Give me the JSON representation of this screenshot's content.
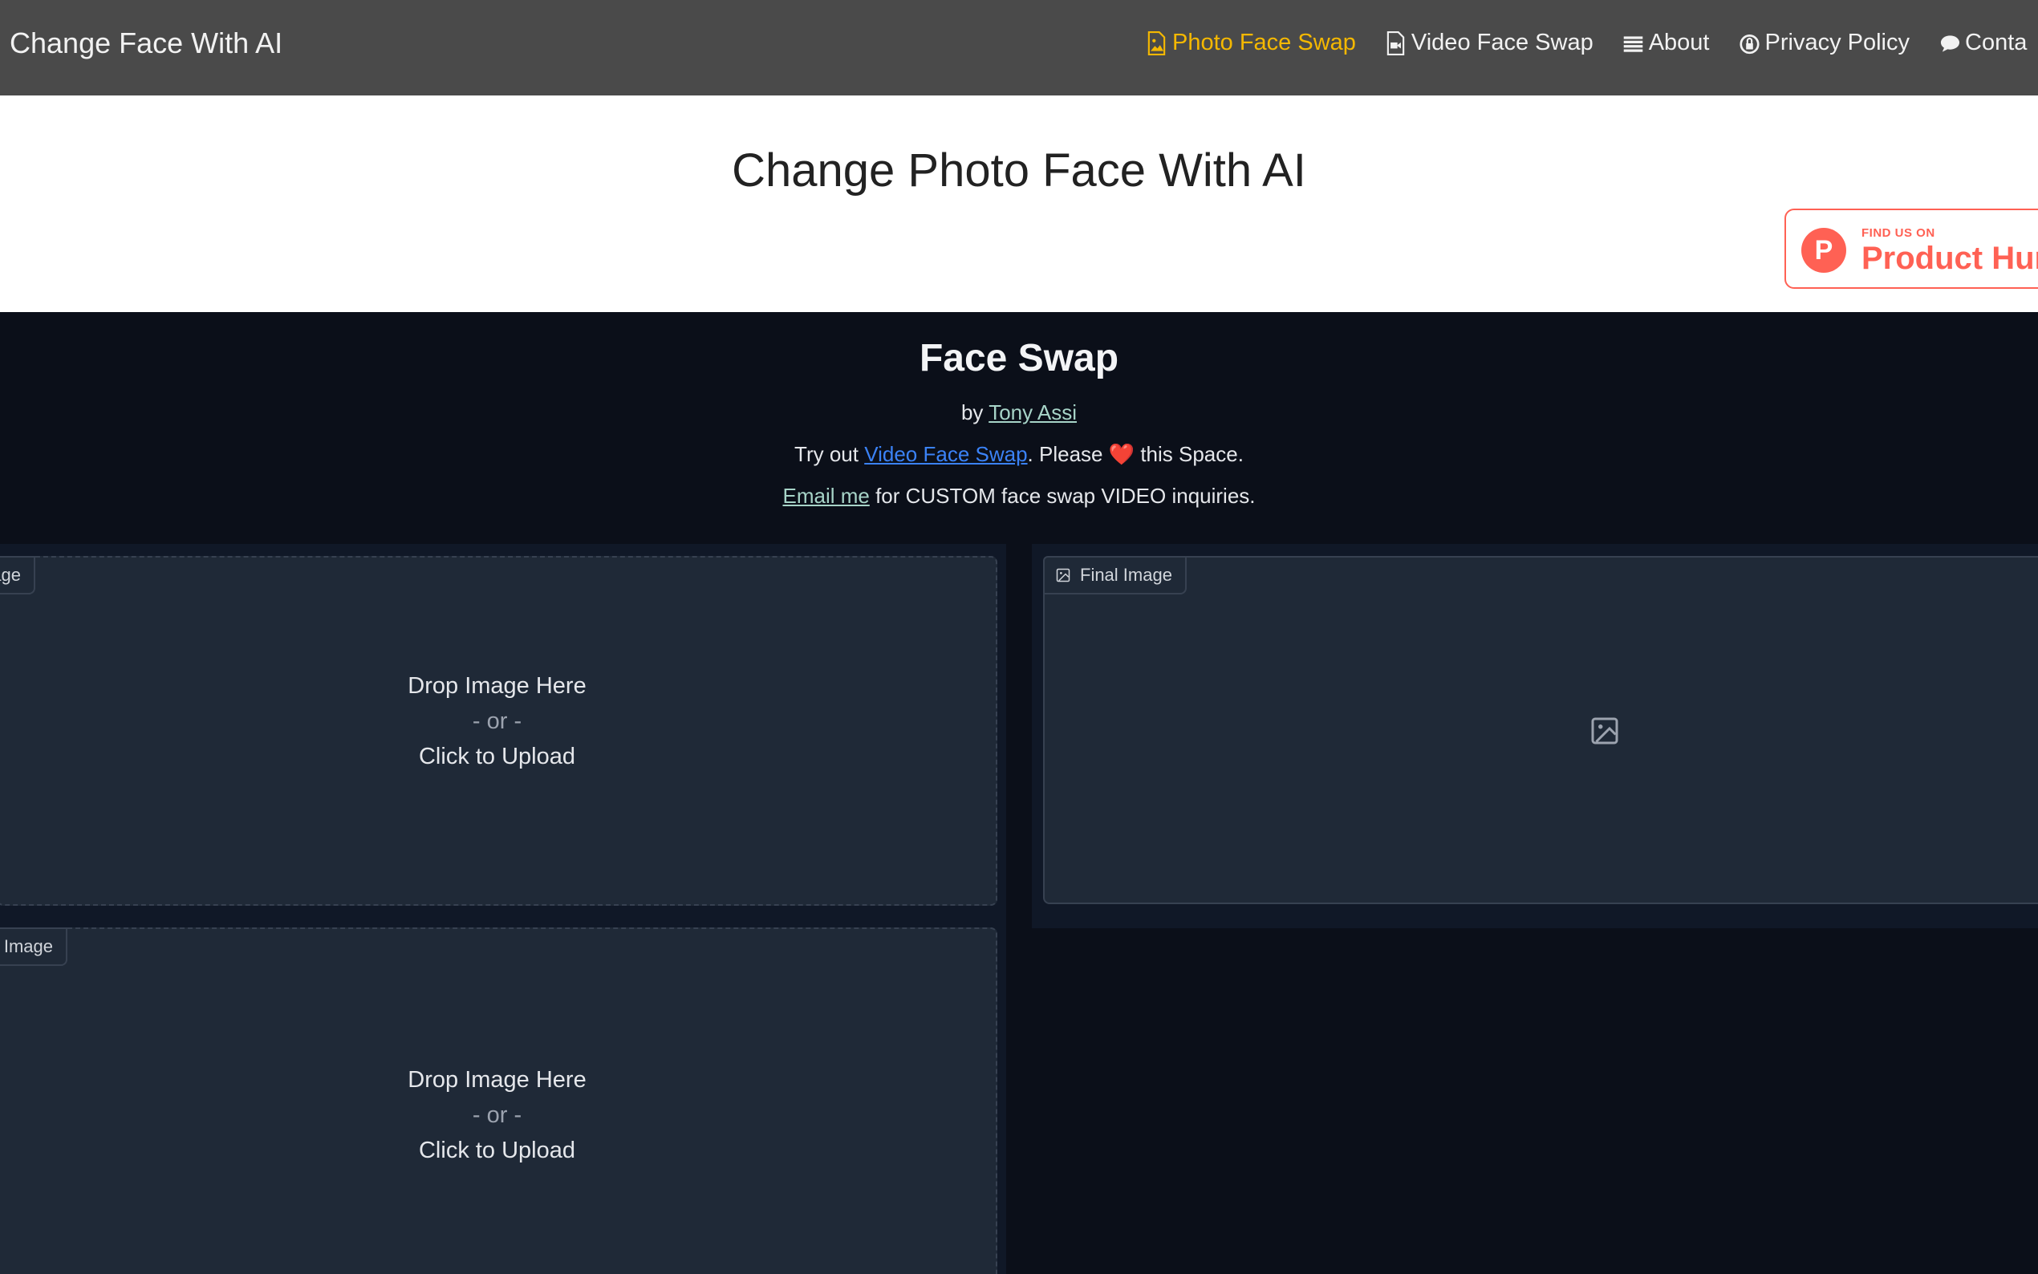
{
  "navbar": {
    "brand": "Change Face With AI",
    "links": [
      {
        "label": "Photo Face Swap",
        "icon": "image-file-icon",
        "active": true
      },
      {
        "label": "Video Face Swap",
        "icon": "video-file-icon",
        "active": false
      },
      {
        "label": "About",
        "icon": "list-icon",
        "active": false
      },
      {
        "label": "Privacy Policy",
        "icon": "lock-icon",
        "active": false
      },
      {
        "label": "Conta",
        "icon": "chat-bubble-icon",
        "active": false
      }
    ],
    "active_color": "#f5b800"
  },
  "header": {
    "title": "Change Photo Face With AI",
    "badge": {
      "logo_letter": "P",
      "find_text": "FIND US ON",
      "name": "Product Hun",
      "color": "#ff6154"
    }
  },
  "app": {
    "title": "Face Swap",
    "byline": {
      "prefix": "by ",
      "author": "Tony Assi"
    },
    "promo": {
      "prefix": "Try out ",
      "link": "Video Face Swap",
      "middle": ". Please ",
      "heart": "❤️",
      "suffix": " this Space."
    },
    "contact": {
      "link": "Email me",
      "suffix": " for CUSTOM face swap VIDEO inquiries."
    },
    "input_1": {
      "label": "age",
      "drop": "Drop Image Here",
      "or": "- or -",
      "upload": "Click to Upload"
    },
    "input_2": {
      "label": "n Image",
      "drop": "Drop Image Here",
      "or": "- or -",
      "upload": "Click to Upload"
    },
    "output": {
      "label": "Final Image",
      "icon": "image-icon"
    }
  }
}
